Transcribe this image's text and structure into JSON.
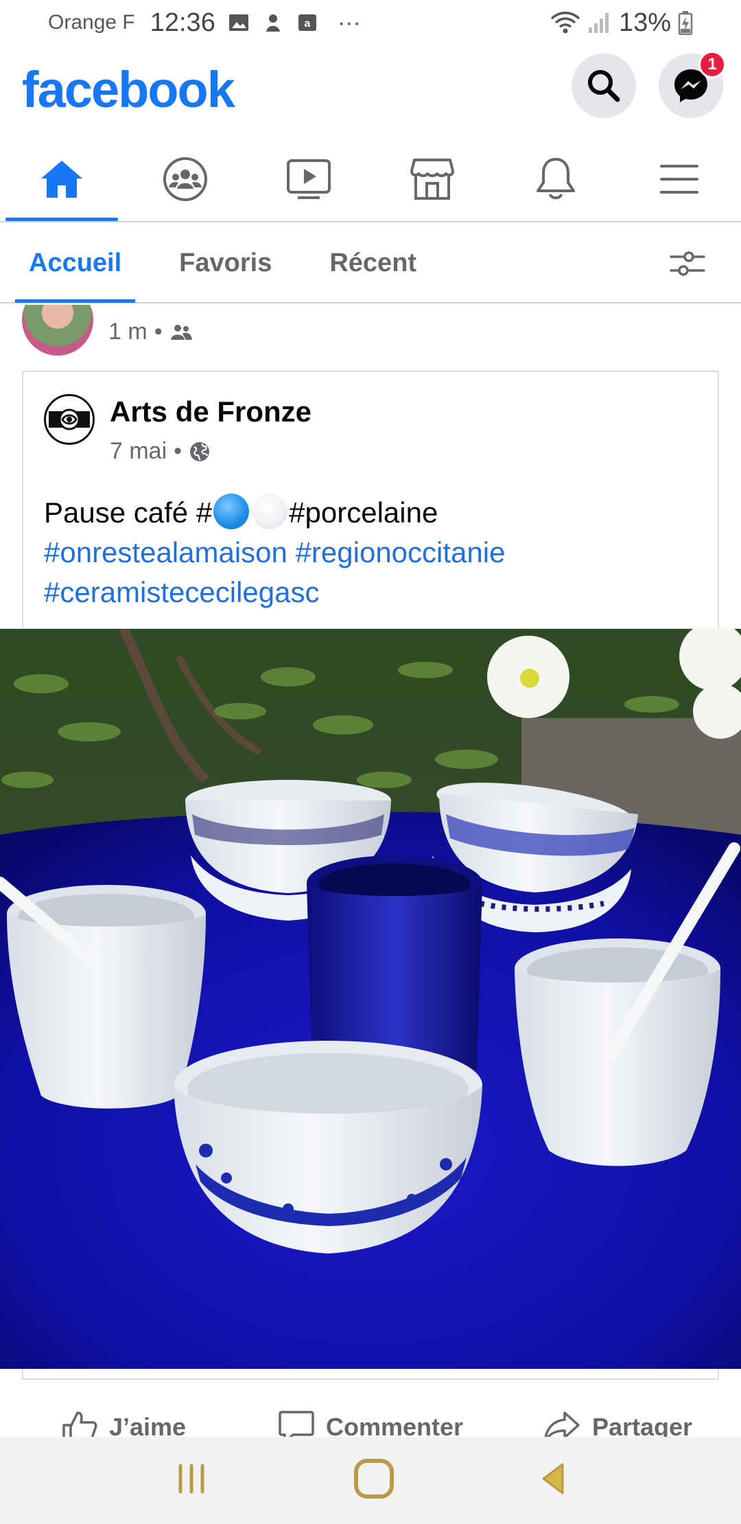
{
  "status_bar": {
    "carrier": "Orange F",
    "time": "12:36",
    "more": "···",
    "battery": "13%"
  },
  "header": {
    "logo": "facebook",
    "messenger_badge": "1",
    "icons": [
      "search-icon",
      "messenger-icon"
    ]
  },
  "nav": {
    "items": [
      {
        "icon": "home-icon",
        "active": true
      },
      {
        "icon": "groups-icon",
        "active": false
      },
      {
        "icon": "watch-icon",
        "active": false
      },
      {
        "icon": "marketplace-icon",
        "active": false
      },
      {
        "icon": "notifications-icon",
        "active": false
      },
      {
        "icon": "menu-icon",
        "active": false
      }
    ]
  },
  "sub_tabs": {
    "items": [
      "Accueil",
      "Favoris",
      "Récent"
    ],
    "active": "Accueil"
  },
  "prev_post": {
    "time": "1 m",
    "separator": "•"
  },
  "shared_post": {
    "author": "Arts de Fronze",
    "date": "7 mai",
    "separator": "•",
    "text_start": "Pause café #",
    "text_tag1": "#porcelaine",
    "hashtags_line2a": "#onrestealamaison",
    "hashtags_line2b": "#regionoccitanie",
    "hashtags_line3": "#ceramistececilegasc"
  },
  "actions": {
    "like": "J’aime",
    "comment": "Commenter",
    "share": "Partager"
  },
  "colors": {
    "brand": "#1877f2",
    "hashtag": "#216fdb",
    "badge": "#e41e3f",
    "muted": "#65676b"
  }
}
